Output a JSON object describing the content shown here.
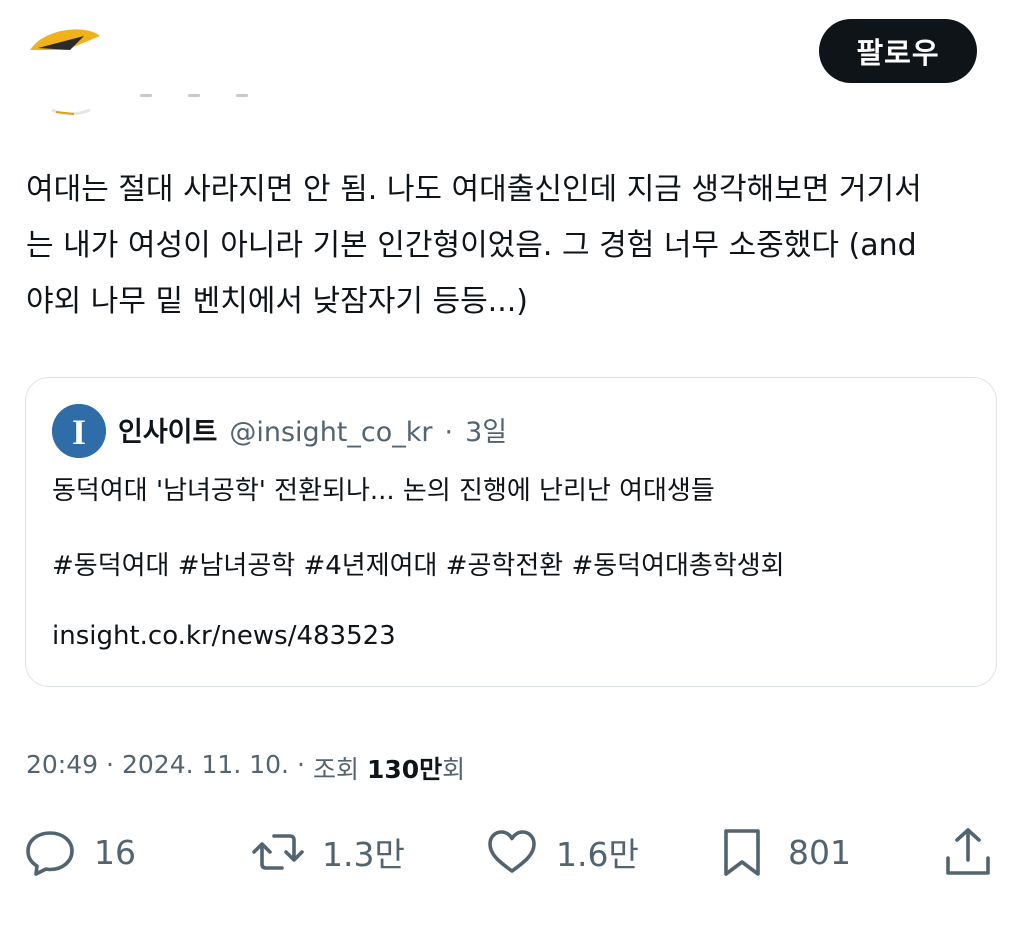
{
  "header": {
    "follow_label": "팔로우"
  },
  "tweet": {
    "text": "여대는 절대 사라지면 안 됨. 나도 여대출신인데 지금 생각해보면 거기서\n는 내가 여성이 아니라 기본 인간형이었음. 그 경험 너무 소중했다 (and\n야외 나무 밑 벤치에서 낮잠자기 등등...)"
  },
  "quote": {
    "name": "인사이트",
    "handle": "@insight_co_kr",
    "separator": "·",
    "time": "3일",
    "title": "동덕여대 '남녀공학' 전환되나... 논의 진행에 난리난 여대생들",
    "hashtags": "#동덕여대 #남녀공학 #4년제여대 #공학전환 #동덕여대총학생회",
    "link": "insight.co.kr/news/483523",
    "avatar_letter": "I"
  },
  "meta": {
    "time": "20:49",
    "sep1": "·",
    "date": "2024. 11. 10.",
    "sep2": "·",
    "views_label": "조회",
    "views_count": "130만",
    "views_unit": "회"
  },
  "actions": {
    "replies": "16",
    "retweets": "1.3만",
    "likes": "1.6만",
    "bookmarks": "801"
  },
  "icons": {
    "reply": "reply-icon",
    "retweet": "retweet-icon",
    "like": "heart-icon",
    "bookmark": "bookmark-icon",
    "share": "share-icon"
  },
  "colors": {
    "text": "#0f1419",
    "secondary": "#536471",
    "border": "#dfe4e8",
    "follow_bg": "#0f1419",
    "quote_avatar": "#2f6da8"
  }
}
